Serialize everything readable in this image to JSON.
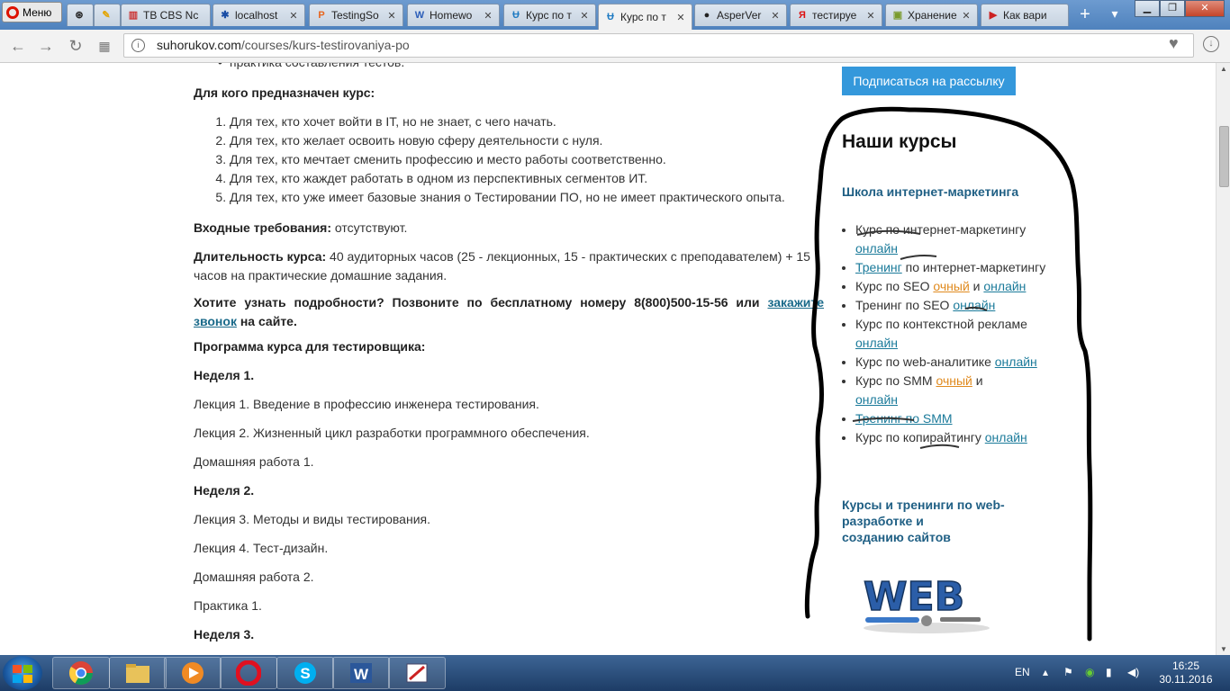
{
  "browser": {
    "menu_label": "Меню",
    "tabs": [
      {
        "title": "ТВ CBS Nc",
        "icon": "tv-icon",
        "color": "#c33"
      },
      {
        "title": "localhost",
        "icon": "settings-icon",
        "color": "#1a4ea5"
      },
      {
        "title": "TestingSo",
        "icon": "p-icon",
        "color": "#e8641c"
      },
      {
        "title": "Homewo",
        "icon": "w-icon",
        "color": "#2b5db8"
      },
      {
        "title": "Курс по т",
        "icon": "site-icon",
        "color": "#1e7ac2"
      },
      {
        "title": "Курс по т",
        "icon": "site-icon",
        "color": "#1e7ac2"
      },
      {
        "title": "AsperVer",
        "icon": "github-icon",
        "color": "#222"
      },
      {
        "title": "тестируе",
        "icon": "yandex-icon",
        "color": "#d11"
      },
      {
        "title": "Хранение",
        "icon": "image-icon",
        "color": "#7a9b2c"
      },
      {
        "title": "Как вари",
        "icon": "video-icon",
        "color": "#c22"
      }
    ],
    "url_domain": "suhorukov.com",
    "url_path": "/courses/kurs-testirovaniya-po"
  },
  "main": {
    "top_bullet": "практика составления тестов.",
    "audience_heading": "Для кого предназначен курс:",
    "audience_items": [
      "Для тех, кто хочет войти в IT, но не знает, с чего начать.",
      "Для тех, кто желает освоить новую сферу деятельности с нуля.",
      "Для тех, кто мечтает сменить профессию и место работы соответственно.",
      "Для тех, кто жаждет работать в одном из перспективных сегментов ИТ.",
      "Для тех, кто уже имеет базовые знания о Тестировании ПО, но не имеет практического опыта."
    ],
    "req_label": "Входные требования:",
    "req_value": " отсутствуют.",
    "dur_label": "Длительность курса:",
    "dur_value": " 40 аудиторных часов (25 - лекционных, 15 - практических с преподавателем) + 15 часов на практические домашние задания.",
    "call_text": "Хотите узнать подробности? Позвоните по бесплатному номеру 8(800)500-15-56 или ",
    "call_link": "закажите звонок",
    "call_tail": " на сайте.",
    "program_heading": "Программа курса для тестировщика:",
    "week1": "Неделя 1.",
    "lecture1": "Лекция 1. Введение в профессию инженера тестирования.",
    "lecture2": "Лекция 2. Жизненный цикл разработки программного обеспечения.",
    "homework1": "Домашняя работа 1.",
    "week2": "Неделя 2.",
    "lecture3": "Лекция 3. Методы и виды тестирования.",
    "lecture4": "Лекция 4. Тест-дизайн.",
    "homework2": "Домашняя работа 2.",
    "practice1": "Практика 1.",
    "week3": "Неделя 3."
  },
  "sidebar": {
    "subscribe": "Подписаться на рассылку",
    "our_courses": "Наши курсы",
    "school_heading": "Школа интернет-маркетинга",
    "web_heading_1": "Курсы и тренинги по web-",
    "web_heading_2": "разработке и",
    "web_heading_3": "созданию сайтов",
    "web_logo": "WEB",
    "items": {
      "i1_text": "Курс по интернет-маркетингу ",
      "i1_link": "онлайн",
      "i2_link": "Тренинг",
      "i2_text": " по интернет-маркетингу",
      "i3_text": "Курс по SEO ",
      "i3_link_a": "очный",
      "i3_mid": " и ",
      "i3_link_b": "онлайн",
      "i4_text": "Тренинг по SEO ",
      "i4_link": "онлайн",
      "i5_text": "Курс по контекстной рекламе ",
      "i5_link": "онлайн",
      "i6_text": "Курс по web-аналитике ",
      "i6_link": "онлайн",
      "i7_text": "Курс по SMM ",
      "i7_link_a": "очный",
      "i7_mid": " и ",
      "i7_link_b": "онлайн",
      "i8_link": "Тренинг по SMM",
      "i9_text": "Курс по копирайтингу ",
      "i9_link": "онлайн"
    }
  },
  "taskbar": {
    "lang": "EN",
    "time": "16:25",
    "date": "30.11.2016"
  }
}
